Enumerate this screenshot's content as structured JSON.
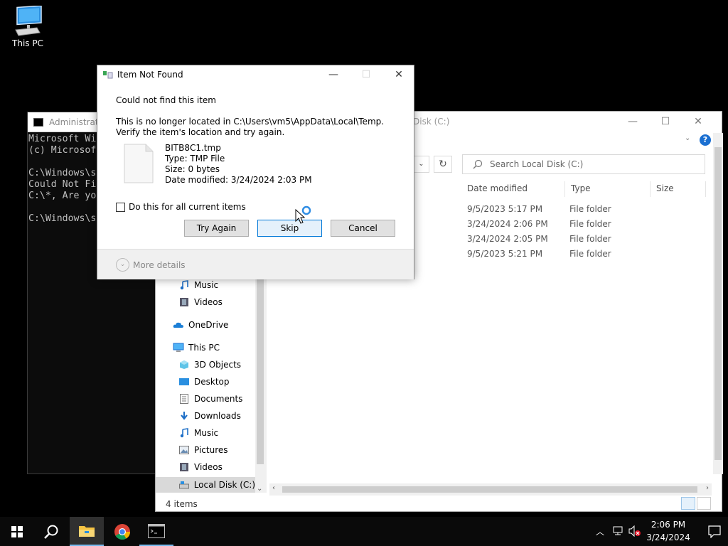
{
  "desktop": {
    "icons": [
      {
        "label": "This PC",
        "icon": "this-pc-icon"
      }
    ]
  },
  "console": {
    "title": "Administrato",
    "lines": [
      "Microsoft Wi",
      "(c) Microsof",
      "",
      "C:\\Windows\\s",
      "Could Not Fi",
      "C:\\*, Are yo",
      "",
      "C:\\Windows\\s"
    ]
  },
  "explorer": {
    "title": "Disk (C:)",
    "search_placeholder": "Search Local Disk (C:)",
    "columns": [
      "Date modified",
      "Type",
      "Size"
    ],
    "rows": [
      {
        "date": "9/5/2023 5:17 PM",
        "type": "File folder"
      },
      {
        "date": "3/24/2024 2:06 PM",
        "type": "File folder"
      },
      {
        "date": "3/24/2024 2:05 PM",
        "type": "File folder"
      },
      {
        "date": "9/5/2023 5:21 PM",
        "type": "File folder"
      }
    ],
    "nav": {
      "music_top": "Music",
      "videos_top": "Videos",
      "onedrive": "OneDrive",
      "this_pc": "This PC",
      "objects3d": "3D Objects",
      "desktop": "Desktop",
      "documents": "Documents",
      "downloads": "Downloads",
      "music": "Music",
      "pictures": "Pictures",
      "videos": "Videos",
      "local_disk": "Local Disk (C:)"
    },
    "status": "4 items",
    "help_label": "?"
  },
  "dialog": {
    "title": "Item Not Found",
    "heading": "Could not find this item",
    "message": "This is no longer located in C:\\Users\\vm5\\AppData\\Local\\Temp. Verify the item's location and try again.",
    "file": {
      "name": "BITB8C1.tmp",
      "type": "Type: TMP File",
      "size": "Size: 0 bytes",
      "modified": "Date modified: 3/24/2024 2:03 PM"
    },
    "checkbox_label": "Do this for all current items",
    "buttons": {
      "try_again": "Try Again",
      "skip": "Skip",
      "cancel": "Cancel"
    },
    "more_details": "More details"
  },
  "taskbar": {
    "clock_time": "2:06 PM",
    "clock_date": "3/24/2024"
  }
}
